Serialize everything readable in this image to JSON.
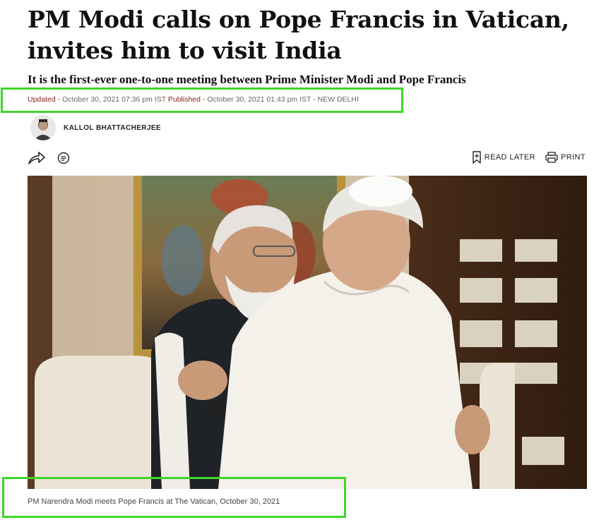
{
  "article": {
    "headline_line1": "PM Modi calls on Pope Francis in Vatican,",
    "headline_line2": "invites him to visit India",
    "subheadline": "It is the first-ever one-to-one meeting between Prime Minister Modi and Pope Francis",
    "meta": {
      "updated_label": "Updated",
      "updated_value": " - October 30, 2021 07:36 pm IST ",
      "published_label": "Published",
      "published_value": " - October 30, 2021 01:43 pm IST - NEW DELHI"
    },
    "author": {
      "name": "KALLOL BHATTACHERJEE"
    },
    "toolbar": {
      "read_later_label": "READ LATER",
      "print_label": "PRINT"
    },
    "photo": {
      "caption": "PM Narendra Modi meets Pope Francis at The Vatican, October 30, 2021"
    }
  },
  "annotations": {
    "highlight_color": "#3fd629"
  },
  "icons": [
    "share-icon",
    "comment-icon",
    "bookmark-icon",
    "print-icon"
  ]
}
